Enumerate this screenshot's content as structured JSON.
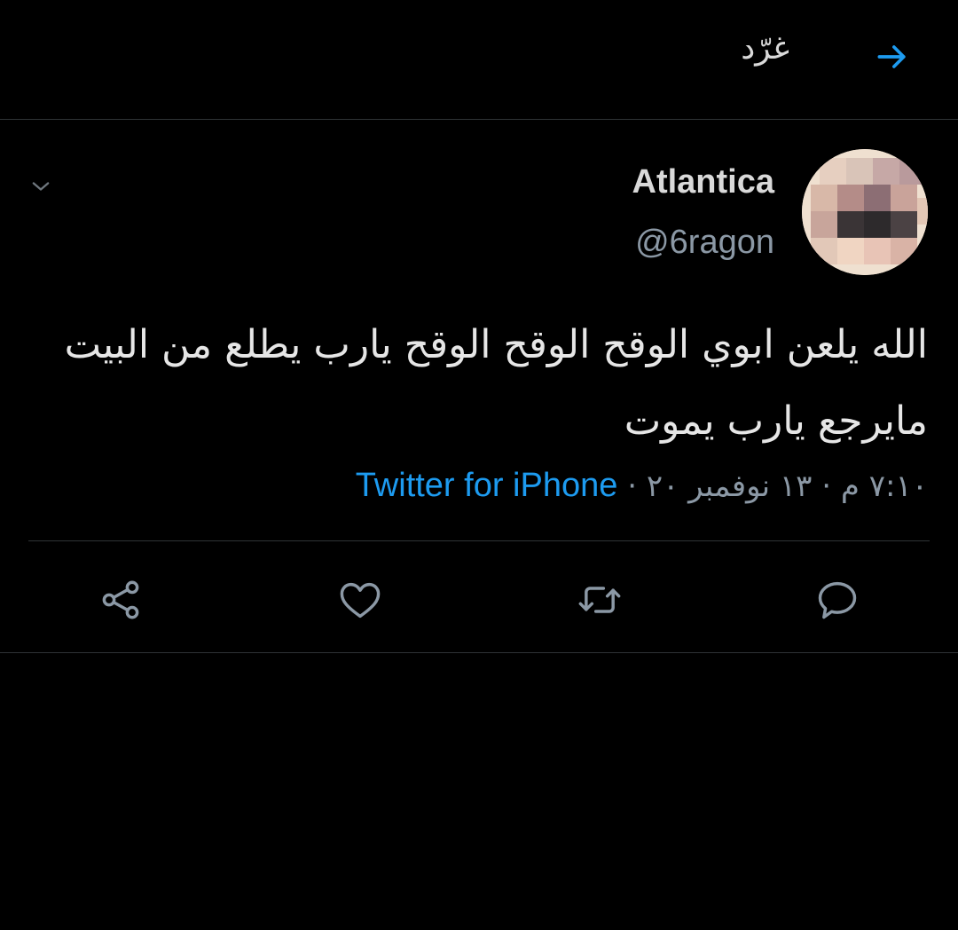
{
  "header": {
    "title": "غرّد",
    "back_icon": "arrow-right-icon",
    "accent": "#1d9bf0"
  },
  "tweet": {
    "display_name": "Atlantica",
    "handle": "@6ragon",
    "text": "الله يلعن ابوي الوقح الوقح الوقح يارب يطلع من البيت مايرجع يارب يموت",
    "time": "٧:١٠ م",
    "date": "١٣ نوفمبر ٢٠",
    "separator": "·",
    "source": "Twitter for iPhone"
  },
  "actions": {
    "icons": [
      "reply-icon",
      "retweet-icon",
      "like-icon",
      "share-icon"
    ]
  },
  "colors": {
    "background": "#000000",
    "text": "#d9d9d9",
    "secondary": "#8b98a5",
    "link": "#1d9bf0",
    "divider": "#2f3336"
  }
}
